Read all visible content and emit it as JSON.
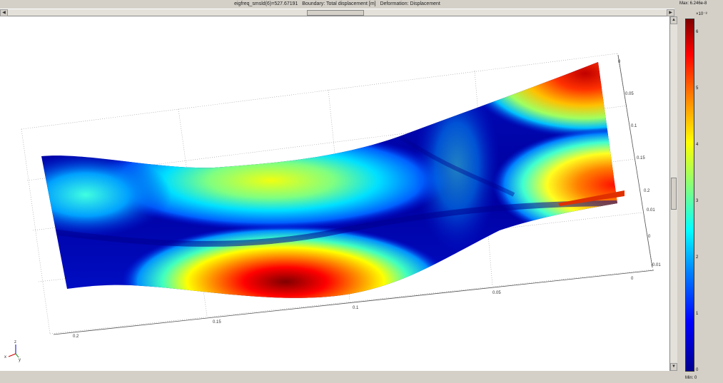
{
  "title_text": "eigfreq_smsld(6)=527.67191   Boundary: Total displacement [m]   Deformation: Displacement",
  "colorbar": {
    "max_label": "Max: 6.246e-8",
    "min_label": "Min: 0",
    "exponent": "×10⁻⁸",
    "ticks": [
      "6",
      "5",
      "4",
      "3",
      "2",
      "1",
      "0"
    ]
  },
  "axes": {
    "bottom_ticks": [
      "0.2",
      "0.15",
      "0.1",
      "0.05",
      "0"
    ],
    "right_ticks": [
      "0",
      "0.05",
      "0.1",
      "0.15",
      "0.2"
    ],
    "z_ticks": [
      "0.01",
      "0",
      "-0.01"
    ],
    "triad": {
      "x": "x",
      "y": "y",
      "z": "z"
    }
  },
  "colors": {
    "colormap": [
      "#00008f",
      "#0000ff",
      "#0080ff",
      "#00ffff",
      "#80ff80",
      "#ffff00",
      "#ff8000",
      "#ff0000",
      "#7f0000"
    ]
  }
}
